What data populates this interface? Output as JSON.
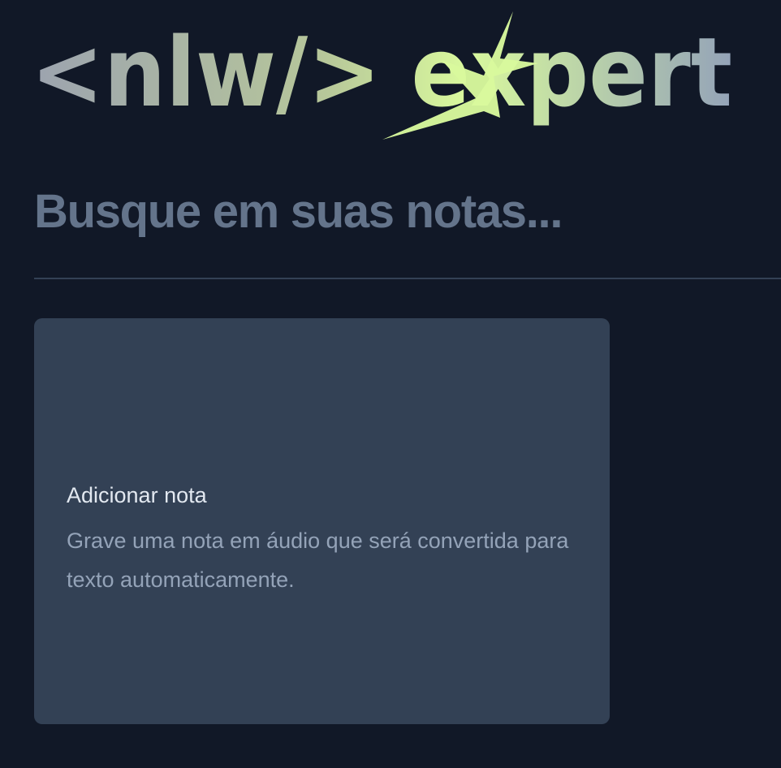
{
  "brand": {
    "logo_text": "<nlw/> expert",
    "colors": {
      "background": "#111827",
      "search_text": "#64748b",
      "divider": "#334155",
      "card": "#334155",
      "card_title": "#e2e8f0",
      "card_description": "#94a3b8",
      "logo_gradient_start": "#9ca3af",
      "logo_gradient_middle": "#d9f99d",
      "logo_gradient_end": "#94a3b8",
      "logo_spark": "#d9f99d"
    },
    "icons": {
      "spark": "sparkle-icon"
    }
  },
  "search": {
    "placeholder": "Busque em suas notas..."
  },
  "add_note_card": {
    "title": "Adicionar nota",
    "description": "Grave uma nota em áudio que será convertida para texto automaticamente."
  }
}
